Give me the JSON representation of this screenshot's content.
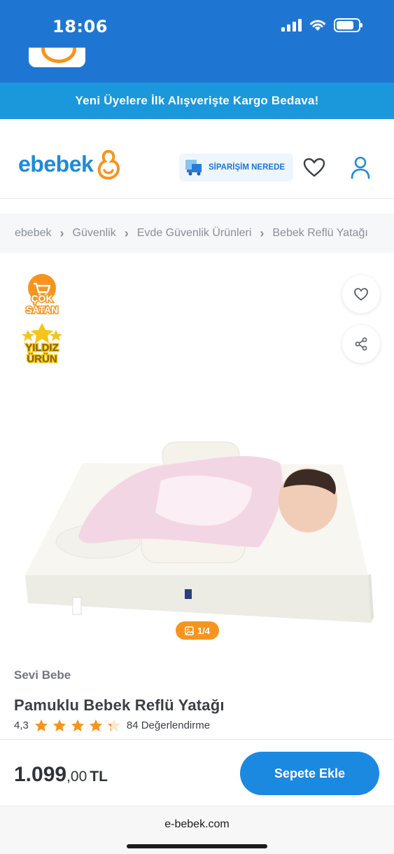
{
  "status_bar": {
    "time": "18:06"
  },
  "promo": {
    "text": "Yeni Üyelere İlk Alışverişte Kargo Bedava!"
  },
  "header": {
    "logo_text": "ebebek",
    "order_label": "SİPARİŞİM NEREDE"
  },
  "breadcrumb": [
    {
      "label": "ebebek"
    },
    {
      "label": "Güvenlik"
    },
    {
      "label": "Evde Güvenlik Ürünleri"
    },
    {
      "label": "Bebek Reflü Yatağı"
    }
  ],
  "badges": {
    "bestseller": {
      "line1": "ÇOK",
      "line2": "SATAN"
    },
    "star": {
      "line1": "YILDIZ",
      "line2": "ÜRÜN"
    }
  },
  "gallery": {
    "counter": "1/4"
  },
  "product": {
    "brand": "Sevi Bebe",
    "title": "Pamuklu Bebek Reflü Yatağı",
    "rating": "4,3",
    "rating_value": 4.3,
    "reviews": "84 Değerlendirme",
    "price_main": "1.099",
    "price_cents": ",00",
    "currency": "TL"
  },
  "cart": {
    "label": "Sepete Ekle"
  },
  "browser": {
    "url": "e-bebek.com"
  },
  "colors": {
    "primary": "#1f76d2",
    "promo": "#1b97dc",
    "accent": "#f7941d",
    "star_yellow": "#f5c518",
    "cart": "#1b89e0"
  }
}
